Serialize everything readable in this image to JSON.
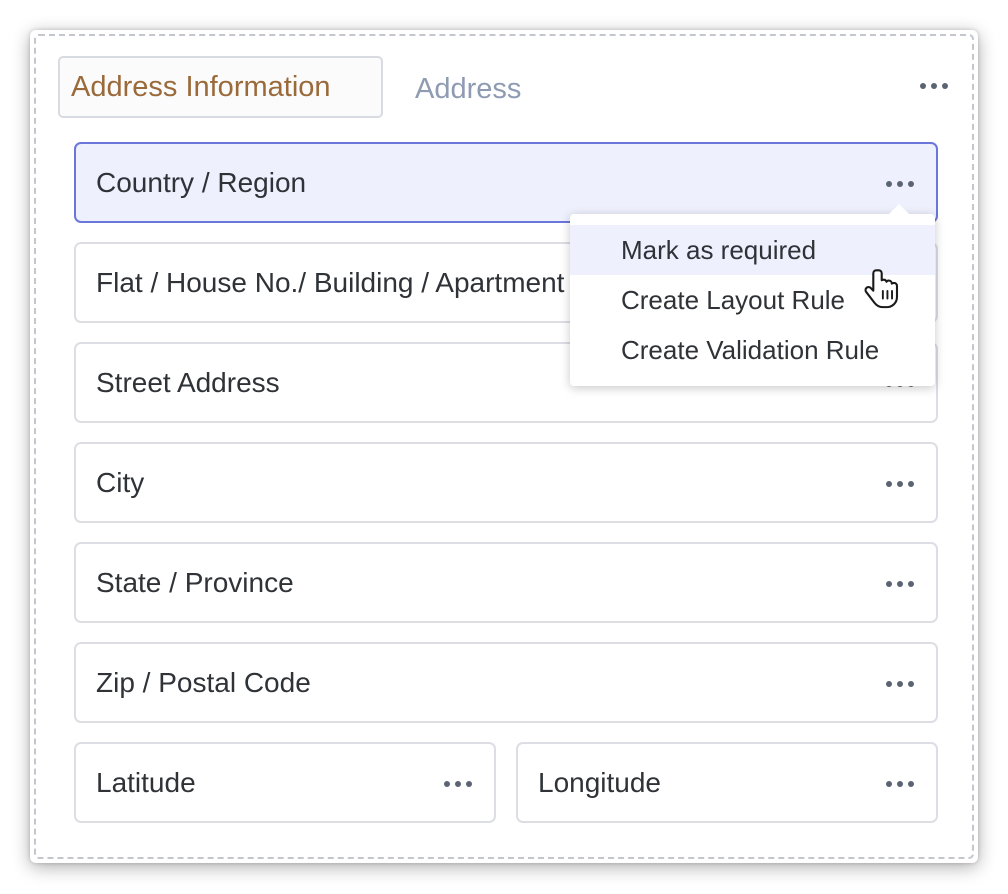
{
  "section": {
    "name": "Address Information",
    "type": "Address"
  },
  "fields": [
    {
      "label": "Country / Region"
    },
    {
      "label": "Flat / House No./ Building / Apartment Name"
    },
    {
      "label": "Street Address"
    },
    {
      "label": "City"
    },
    {
      "label": "State / Province"
    },
    {
      "label": "Zip / Postal Code"
    },
    {
      "label": "Latitude"
    },
    {
      "label": "Longitude"
    }
  ],
  "menu": {
    "items": [
      {
        "label": "Mark as required"
      },
      {
        "label": "Create Layout Rule"
      },
      {
        "label": "Create Validation Rule"
      }
    ]
  },
  "colors": {
    "section_name_text": "#9a6a3a",
    "section_type_text": "#8e9bb3",
    "active_field_bg": "#eef0fd",
    "active_field_border": "#6b76db"
  },
  "icons": {
    "more": "more-horizontal-icon",
    "cursor": "hand-pointer-icon"
  }
}
